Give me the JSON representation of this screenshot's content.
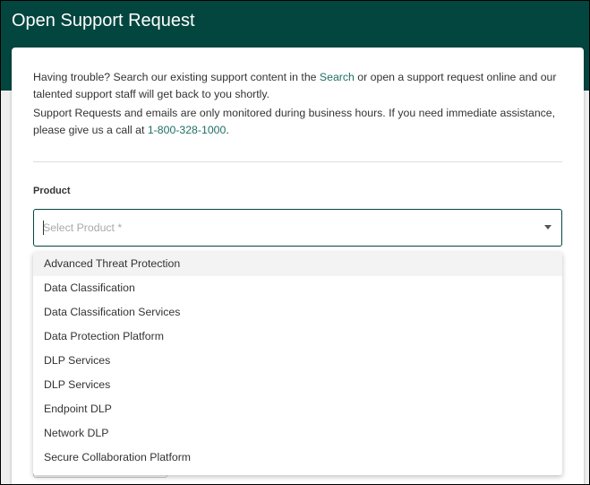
{
  "header": {
    "title": "Open Support Request"
  },
  "intro": {
    "line1_before": "Having trouble? Search our existing support content in the ",
    "search_link": "Search",
    "line1_after": " or open a support request online and our talented support staff will get back to you shortly.",
    "line2_before": "Support Requests and emails are only monitored during business hours. If you need immediate assistance, please give us a call at ",
    "phone_link": "1-800-328-1000",
    "line2_after": "."
  },
  "product_field": {
    "label": "Product",
    "placeholder": "Select Product *",
    "value": ""
  },
  "dropdown": {
    "options": [
      "Advanced Threat Protection",
      "Data Classification",
      "Data Classification Services",
      "Data Protection Platform",
      "DLP Services",
      "DLP Services",
      "Endpoint DLP",
      "Network DLP",
      "Secure Collaboration Platform"
    ],
    "highlighted_index": 0
  },
  "colors": {
    "header_bg": "#03463f",
    "accent": "#1f6f66"
  }
}
